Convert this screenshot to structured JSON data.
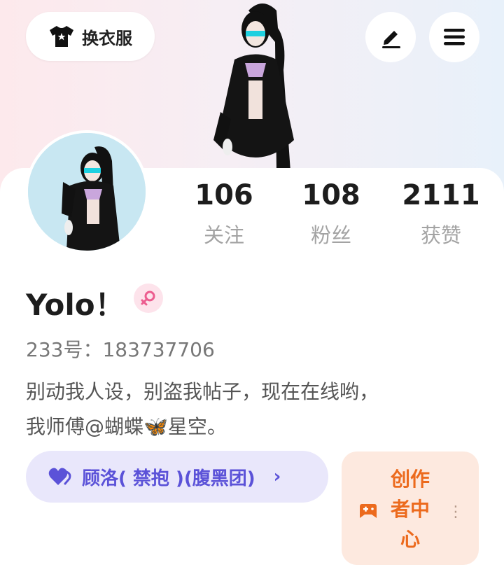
{
  "header": {
    "outfit_button_label": "换衣服"
  },
  "profile": {
    "name": "Yolo！",
    "uid_text": "233号：183737706",
    "bio_line1": "别动我人设，别盗我帖子，现在在线哟，",
    "bio_line2": "我师傅@蝴蝶🦋星空。"
  },
  "stats": [
    {
      "value": "106",
      "label": "关注"
    },
    {
      "value": "108",
      "label": "粉丝"
    },
    {
      "value": "2111",
      "label": "获赞"
    }
  ],
  "group": {
    "label": "顾洛( 禁抱 )(腹黑团)"
  },
  "creator": {
    "label": "创作者中心"
  },
  "colors": {
    "group_accent": "#5b52d8",
    "creator_accent": "#ec6a1d",
    "gender_pink": "#ec5d8f"
  },
  "icons": {
    "outfit": "tshirt-icon",
    "edit": "pencil-icon",
    "menu": "menu-icon",
    "gender": "female-icon",
    "group": "heart-icon",
    "creator": "gamepad-icon"
  }
}
